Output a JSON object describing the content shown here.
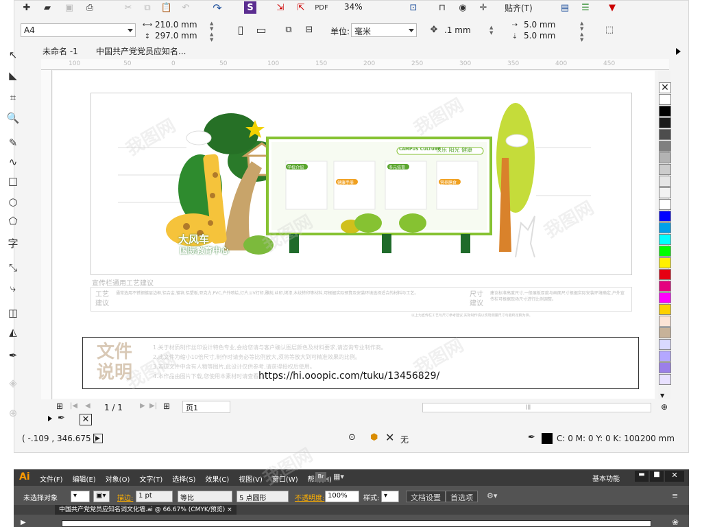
{
  "toolbar1": {
    "zoom": "34%",
    "snap": "贴齐(T)"
  },
  "propbar": {
    "page_size": "A4",
    "width": "210.0 mm",
    "height": "297.0 mm",
    "unit_label": "单位:",
    "unit": "毫米",
    "nudge": ".1 mm",
    "dup_x": "5.0 mm",
    "dup_y": "5.0 mm"
  },
  "tabs": [
    {
      "label": "未命名 -1"
    },
    {
      "label": "中国共产党党员应知名..."
    }
  ],
  "ruler": {
    "ticks": [
      "100",
      "50",
      "0",
      "50",
      "100",
      "150",
      "200",
      "250",
      "300",
      "350",
      "400",
      "450"
    ]
  },
  "design": {
    "logo_line1": "大风车",
    "logo_line2": "国际教育中心",
    "board_campus": "CAMPUS CULTURE",
    "board_slogan": "快乐 阳光 健康",
    "board_tags": [
      "学校介绍",
      "健康手册",
      "多元培育",
      "营养膳食"
    ],
    "craft_title": "宣传栏通用工艺建议",
    "craft_label1": "工艺\n建议",
    "craft_label2": "尺寸\n建议",
    "craft_text1": "通常选用不锈钢镀层边框,铝合金,镀锌,铝塑板,亚克力,PVC,户外喷绘,灯片,UV打印,雕刻,丝印,烤漆,木纹转印等材料,可根据实际预算及安装环境选择适合的材料与工艺。",
    "craft_text2": "建议标准高度尺寸,一般展板厚度与画面尺寸根据实际安装环境确定,户外宣传栏可根据现场尺寸进行比例调整。",
    "craft_footer": "以上为宣传栏工艺与尺寸参考建议,实际制作请以现场测量尺寸与最终定稿为准。",
    "notice_title": "文件说明",
    "notice_lines": [
      "1.关于材质制作丝印设计特色专业,会给您请与客户确认图层颜色及材料要求,请咨询专业制作商。",
      "2.此文件为缩小10倍尺寸,制作时请务必等比例放大,须将等放大到可精准效果的比例。",
      "3.若该文件中含有人物等图片,此设计仅供参考,请获得授权后使用。",
      "4.本作品由图片下载,您使用本素材时请查看。"
    ],
    "notice_url": "https://hi.ooopic.com/tuku/13456829/"
  },
  "pagenav": {
    "count": "1 / 1",
    "page": "页1"
  },
  "status": {
    "coords": "( -.109 , 346.675 )",
    "fill_none": "无",
    "outline": "C: 0 M: 0 Y: 0 K: 100",
    "stroke": ".200 mm"
  },
  "palette": [
    "#ffffff",
    "#000000",
    "#1a1a1a",
    "#4d4d4d",
    "#808080",
    "#b3b3b3",
    "#cccccc",
    "#e6e6e6",
    "#f2f2f2",
    "#ffffff",
    "#0000ff",
    "#00a0e9",
    "#00ffff",
    "#00ff00",
    "#fff100",
    "#e60012",
    "#e4007f",
    "#ff00ff",
    "#fdd000",
    "#fce4d6",
    "#c7b299",
    "#d9d9ff",
    "#b4a7ff",
    "#9b7fe8",
    "#e8e0ff"
  ],
  "ai": {
    "logo": "Ai",
    "menu": [
      "文件(F)",
      "编辑(E)",
      "对象(O)",
      "文字(T)",
      "选择(S)",
      "效果(C)",
      "视图(V)",
      "窗口(W)",
      "帮助(H)"
    ],
    "workspace": "基本功能",
    "no_selection": "未选择对象",
    "stroke_label": "描边:",
    "stroke_value": "1 pt",
    "line_style": "等比",
    "brush": "5 点圆形",
    "opacity_label": "不透明度:",
    "opacity": "100%",
    "style_label": "样式:",
    "doc_setup": "文档设置",
    "prefs": "首选项",
    "doc_tab": "中国共产党党员应知名词文化墙.ai @ 66.67% (CMYK/预览)",
    "close": "×"
  },
  "watermark": "我图网"
}
